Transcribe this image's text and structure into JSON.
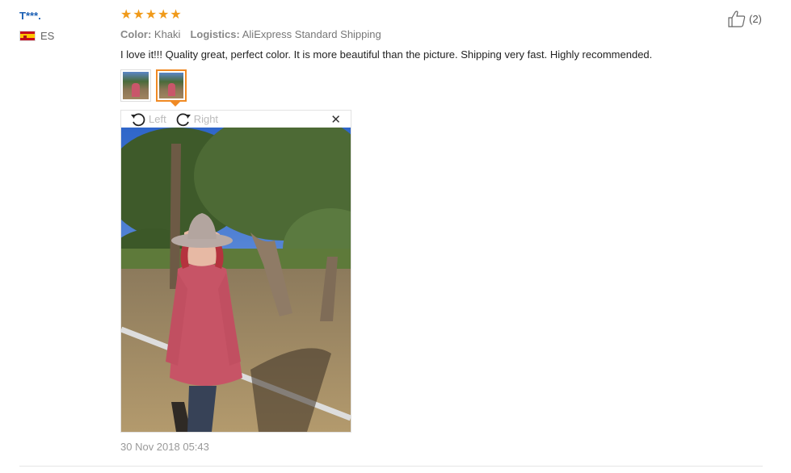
{
  "reviewer": {
    "name": "T***.",
    "country": "ES",
    "flag_icon": "spain-flag-icon"
  },
  "rating": {
    "stars": 5,
    "max": 5,
    "color": "#f09a1a"
  },
  "helpful": {
    "count_label": "(2)",
    "icon": "thumbs-up-icon"
  },
  "attributes": {
    "color_label": "Color:",
    "color_value": "Khaki",
    "logistics_label": "Logistics:",
    "logistics_value": "AliExpress Standard Shipping"
  },
  "review_text": "I love it!!! Quality great, perfect color. It is more beautiful than the picture. Shipping very fast. Highly recommended.",
  "thumbnails": {
    "count": 2,
    "active_index": 1,
    "active_color": "#f08a24"
  },
  "viewer": {
    "rotate_left_label": "Left",
    "rotate_right_label": "Right",
    "close_icon": "close-icon"
  },
  "date": "30 Nov 2018 05:43"
}
